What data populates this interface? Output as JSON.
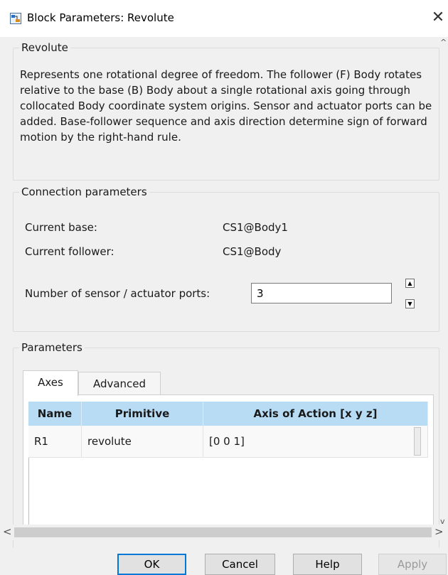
{
  "window": {
    "title": "Block Parameters: Revolute",
    "close_glyph": "✕",
    "icon": "simulink-block-icon"
  },
  "revolute": {
    "legend": "Revolute",
    "description": "Represents one rotational degree of freedom. The follower (F) Body rotates relative to the base (B) Body about a single rotational axis going through collocated Body coordinate system origins. Sensor and actuator ports can be added. Base-follower sequence and axis direction determine sign of forward motion by the right-hand rule."
  },
  "connection": {
    "legend": "Connection parameters",
    "current_base_label": "Current base:",
    "current_base_value": "CS1@Body1",
    "current_follower_label": "Current follower:",
    "current_follower_value": "CS1@Body",
    "ports_label": "Number of sensor / actuator ports:",
    "ports_value": "3",
    "spin_up": "▲",
    "spin_down": "▼"
  },
  "parameters": {
    "legend": "Parameters",
    "tabs": [
      {
        "label": "Axes",
        "active": true
      },
      {
        "label": "Advanced",
        "active": false
      }
    ],
    "table": {
      "columns": [
        "Name",
        "Primitive",
        "Axis of Action [x y z]"
      ],
      "rows": [
        {
          "name": "R1",
          "primitive": "revolute",
          "axis": "[0 0 1]"
        }
      ]
    }
  },
  "scrollbars": {
    "left_arrow": "<",
    "right_arrow": ">",
    "up_arrow": "^",
    "down_arrow": "v"
  },
  "buttons": {
    "ok": "OK",
    "cancel": "Cancel",
    "help": "Help",
    "apply": "Apply"
  },
  "colors": {
    "header_bg": "#b9dcf5",
    "ok_border": "#0078d7"
  }
}
